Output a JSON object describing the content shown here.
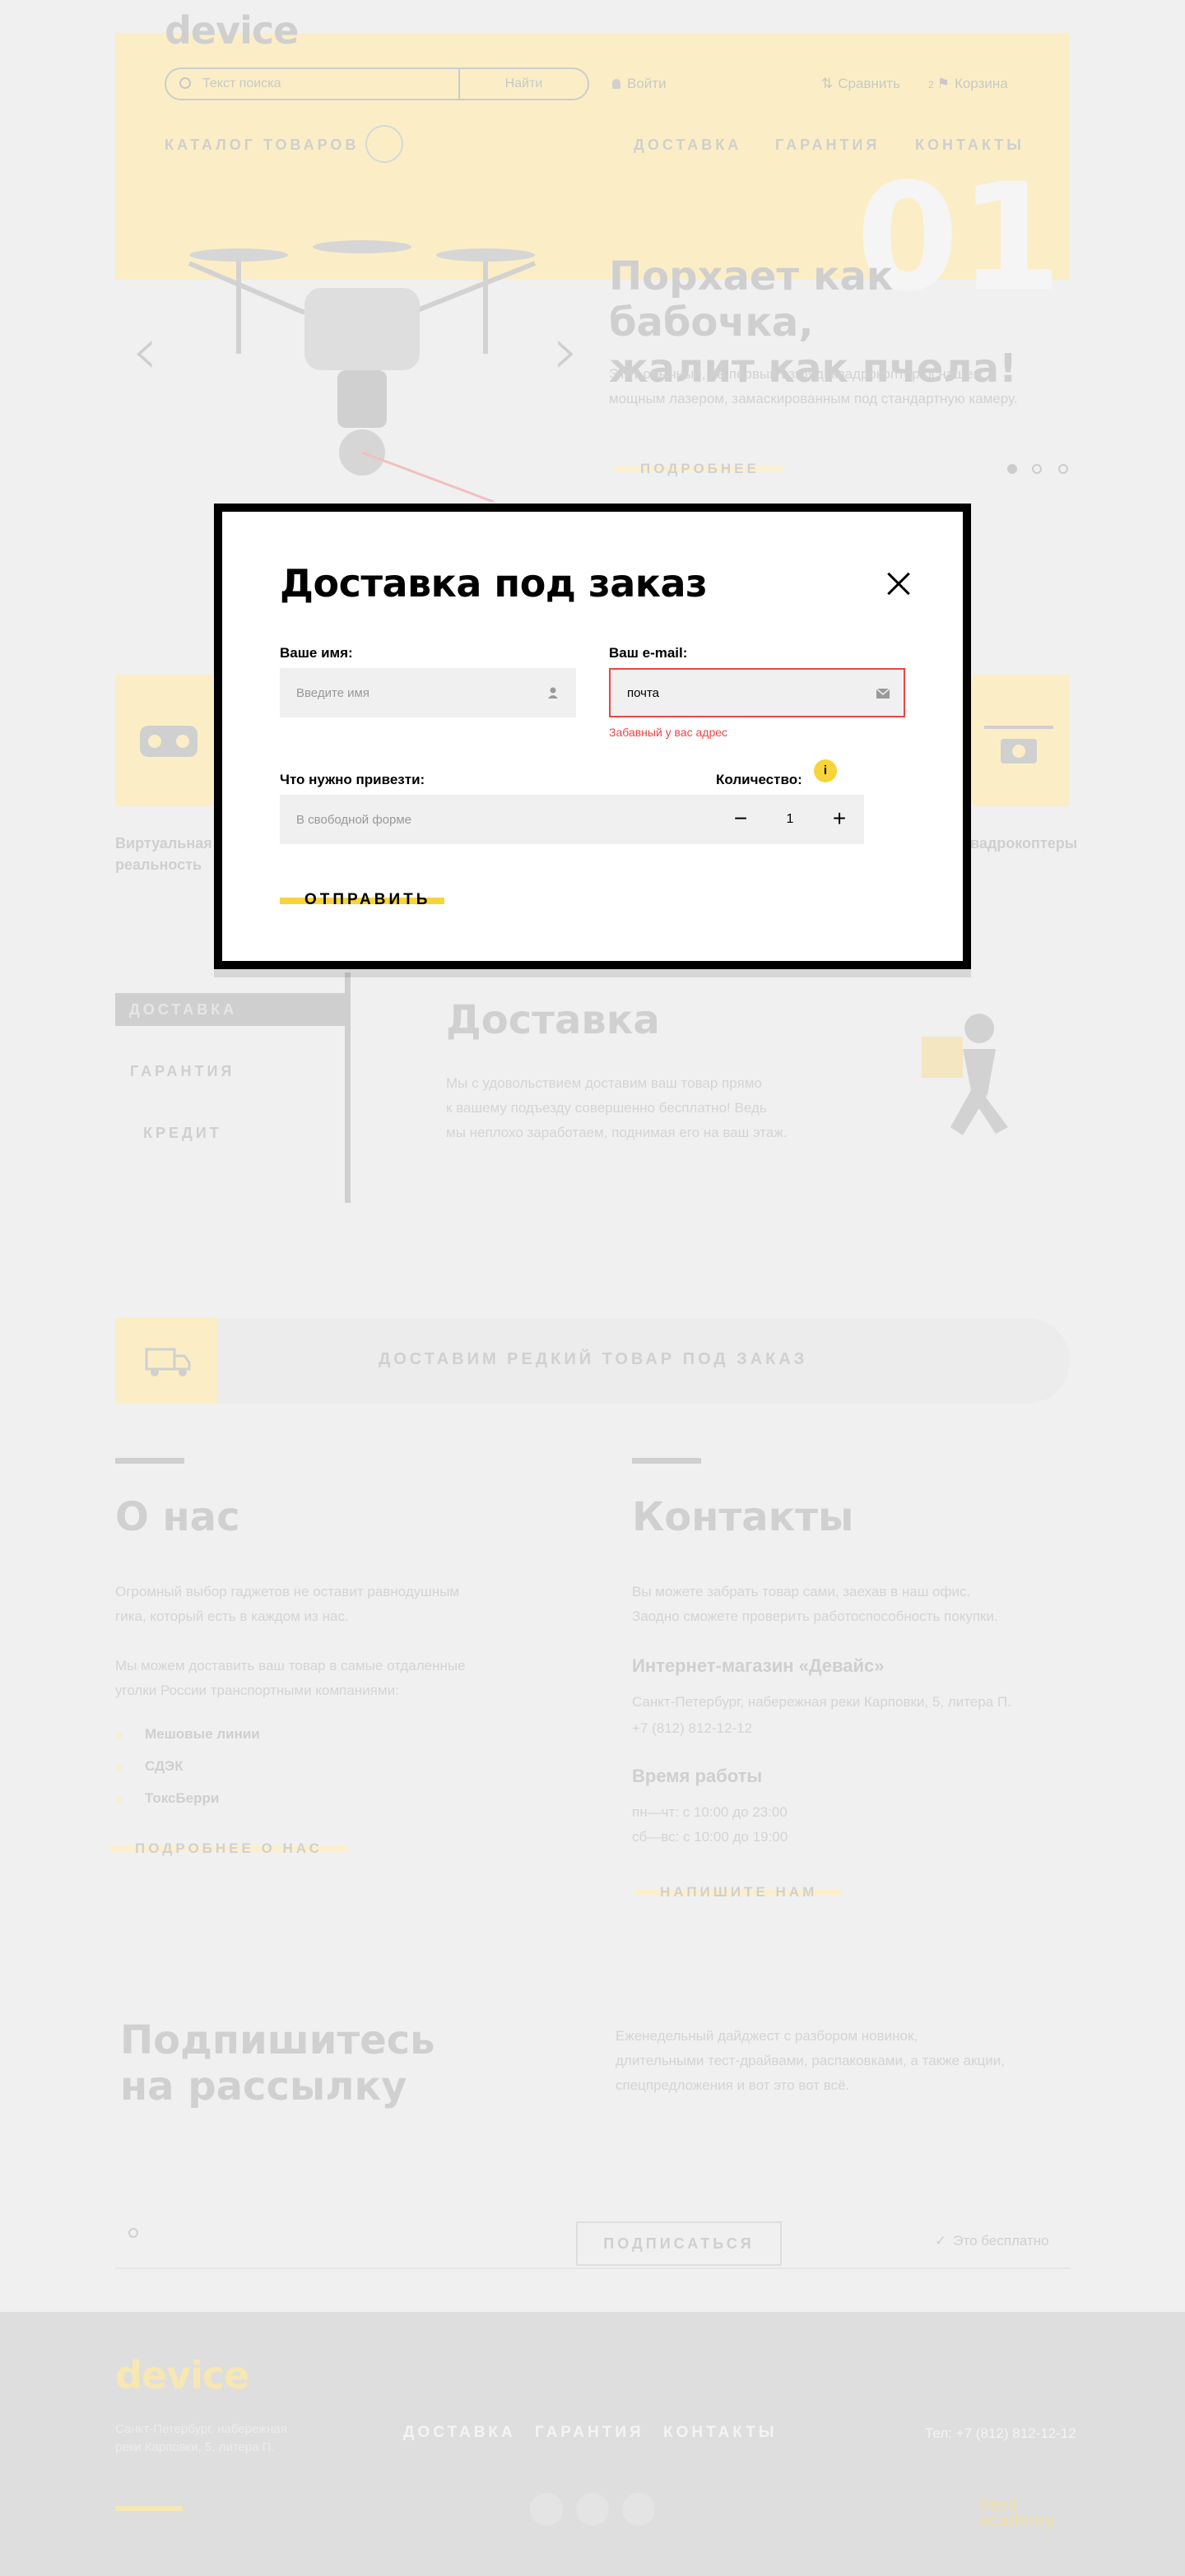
{
  "header": {
    "logo": "device",
    "search_placeholder": "Текст поиска",
    "search_button": "Найти",
    "login": "Войти",
    "compare": "Сравнить",
    "cart_count": "2",
    "cart": "Корзина",
    "catalog": "КАТАЛОГ ТОВАРОВ",
    "nav": [
      "ДОСТАВКА",
      "ГАРАНТИЯ",
      "КОНТАКТЫ"
    ]
  },
  "hero": {
    "slide_number": "01",
    "title_line1": "Порхает как бабочка,",
    "title_line2": "жалит как пчела!",
    "text_line1": "Этот обычный, на первый взгляд, квадрокоптер оснащен",
    "text_line2": "мощным лазером, замаскированным под стандартную камеру.",
    "more": "ПОДРОБНЕЕ",
    "prev_arrow": "‹",
    "next_arrow": "›"
  },
  "categories": {
    "left_line1": "Виртуальная",
    "left_line2": "реальность",
    "right_label": "Квадрокоптеры"
  },
  "services": {
    "tab_active": "ДОСТАВКА",
    "tab_guarantee": "ГАРАНТИЯ",
    "tab_credit": "КРЕДИТ",
    "title": "Доставка",
    "text_line1": "Мы с удовольствием доставим ваш товар прямо",
    "text_line2": "к вашему подъезду совершенно бесплатно! Ведь",
    "text_line3": "мы неплохо заработаем, поднимая его на ваш этаж."
  },
  "banner": {
    "text": "ДОСТАВИМ РЕДКИЙ ТОВАР ПОД ЗАКАЗ"
  },
  "about": {
    "title": "О нас",
    "p1_line1": "Огромный выбор гаджетов не оставит равнодушным",
    "p1_line2": "гика, который есть в каждом из нас.",
    "p2_line1": "Мы можем доставить ваш товар в самые отдаленные",
    "p2_line2": "уголки России транспортными компаниями:",
    "companies": [
      "Мешовые линии",
      "СДЭК",
      "ТоксБерри"
    ],
    "more": "ПОДРОБНЕЕ О НАС"
  },
  "contacts": {
    "title": "Контакты",
    "p_line1": "Вы можете забрать товар сами, заехав в наш офис.",
    "p_line2": "Заодно сможете проверить работоспособность покупки.",
    "shop": "Интернет-магазин «Девайс»",
    "address": "Санкт-Петербург, набережная реки Карповки, 5, литера П.",
    "phone": "+7 (812) 812-12-12",
    "hours_title": "Время работы",
    "hours_1": "пн—чт: с 10:00 до 23:00",
    "hours_2": "сб—вс: с 10:00 до 19:00",
    "write": "НАПИШИТЕ НАМ"
  },
  "subscribe": {
    "title_line1": "Подпишитесь",
    "title_line2": "на рассылку",
    "text_line1": "Еженедельный дайджест с разбором новинок,",
    "text_line2": "длительными тест-драйвами, распаковками, а также акции,",
    "text_line3": "спецпредложения и вот это вот всё.",
    "button": "ПОДПИСАТЬСЯ",
    "free": "Это бесплатно"
  },
  "footer": {
    "logo": "device",
    "address_line1": "Санкт-Петербург, набережная",
    "address_line2": "реки Карповки, 5, литера П.",
    "nav": [
      "ДОСТАВКА",
      "ГАРАНТИЯ",
      "КОНТАКТЫ"
    ],
    "phone": "Тел: +7 (812) 812-12-12",
    "academy_line1": "html",
    "academy_line2": "academy"
  },
  "modal": {
    "title": "Доставка под заказ",
    "name_label": "Ваше имя:",
    "name_placeholder": "Введите имя",
    "email_label": "Ваш e-mail:",
    "email_value": "почта",
    "email_error": "Забавный у вас адрес",
    "what_label": "Что нужно привезти:",
    "what_placeholder": "В свободной форме",
    "qty_label": "Количество:",
    "qty_info": "i",
    "qty_minus": "−",
    "qty_value": "1",
    "qty_plus": "+",
    "submit": "ОТПРАВИТЬ"
  },
  "colors": {
    "accent": "#f7d43a",
    "error": "#ee4444",
    "page_bg": "#f0f0f0",
    "modal_border": "#000000"
  }
}
